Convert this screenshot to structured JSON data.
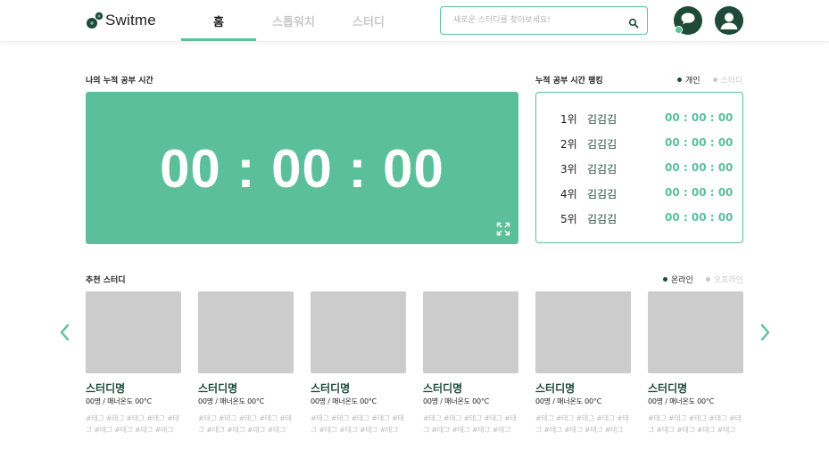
{
  "header": {
    "logo_text": "Switme",
    "tabs": [
      {
        "label": "홈",
        "active": true
      },
      {
        "label": "스톱워치",
        "active": false
      },
      {
        "label": "스터디",
        "active": false
      }
    ],
    "search_placeholder": "새로운 스터디를 찾아보세요!"
  },
  "my_time": {
    "title": "나의 누적 공부 시간",
    "timer": "00 : 00 : 00"
  },
  "ranking": {
    "title": "누적 공부 시간 랭킹",
    "toggle": [
      {
        "label": "개인",
        "selected": true
      },
      {
        "label": "스터디",
        "selected": false
      }
    ],
    "rows": [
      {
        "rank": "1위",
        "name": "김김김",
        "time": "00 : 00 : 00"
      },
      {
        "rank": "2위",
        "name": "김김김",
        "time": "00 : 00 : 00"
      },
      {
        "rank": "3위",
        "name": "김김김",
        "time": "00 : 00 : 00"
      },
      {
        "rank": "4위",
        "name": "김김김",
        "time": "00 : 00 : 00"
      },
      {
        "rank": "5위",
        "name": "김김김",
        "time": "00 : 00 : 00"
      }
    ]
  },
  "recommend": {
    "title": "추천 스터디",
    "toggle": [
      {
        "label": "온라인",
        "selected": true
      },
      {
        "label": "오프라인",
        "selected": false
      }
    ],
    "cards": [
      {
        "name": "스터디명",
        "meta": "00명 / 매너온도 00°C",
        "tags": "#태그 #태그 #태그 #태그 #태그 #태그 #태그 #태그 #태그"
      },
      {
        "name": "스터디명",
        "meta": "00명 / 매너온도 00°C",
        "tags": "#태그 #태그 #태그 #태그 #태그 #태그 #태그 #태그 #태그"
      },
      {
        "name": "스터디명",
        "meta": "00명 / 매너온도 00°C",
        "tags": "#태그 #태그 #태그 #태그 #태그 #태그 #태그 #태그 #태그"
      },
      {
        "name": "스터디명",
        "meta": "00명 / 매너온도 00°C",
        "tags": "#태그 #태그 #태그 #태그 #태그 #태그 #태그 #태그 #태그"
      },
      {
        "name": "스터디명",
        "meta": "00명 / 매너온도 00°C",
        "tags": "#태그 #태그 #태그 #태그 #태그 #태그 #태그 #태그 #태그"
      },
      {
        "name": "스터디명",
        "meta": "00명 / 매너온도 00°C",
        "tags": "#태그 #태그 #태그 #태그 #태그 #태그 #태그 #태그 #태그"
      }
    ]
  },
  "icons": {
    "logo": "logo-mark-icon",
    "search": "search-icon",
    "chat": "chat-icon",
    "profile": "user-icon",
    "expand": "expand-icon",
    "prev": "chevron-left-icon",
    "next": "chevron-right-icon"
  },
  "colors": {
    "accent": "#5bbf9c",
    "dark": "#1f4a3a",
    "placeholder": "#cccccc"
  }
}
